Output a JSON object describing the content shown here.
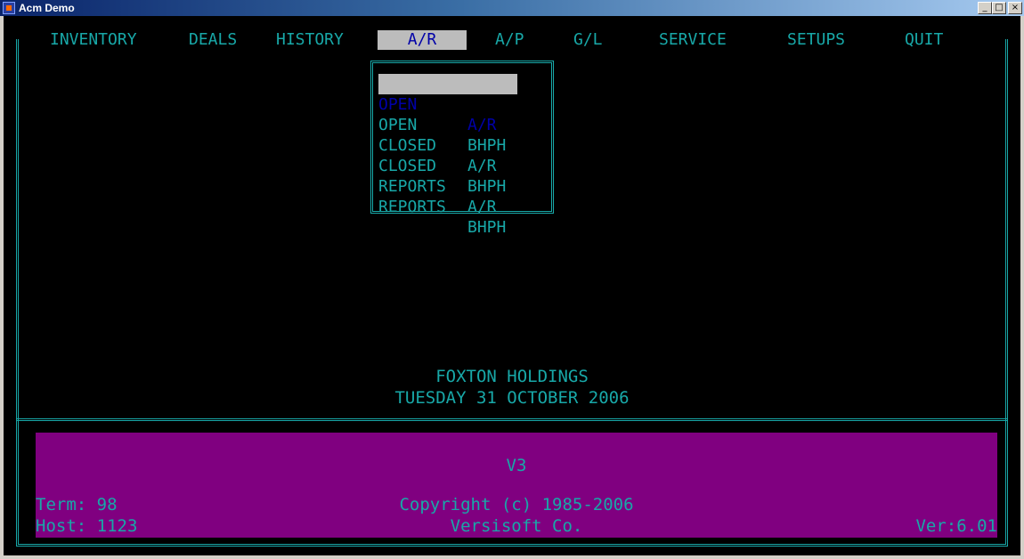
{
  "window": {
    "title": "Acm Demo",
    "controls": {
      "minimize": "_",
      "maximize": "□",
      "close": "×"
    }
  },
  "menu": {
    "items": [
      {
        "label": "INVENTORY"
      },
      {
        "label": "DEALS"
      },
      {
        "label": "HISTORY"
      },
      {
        "label": "A/R",
        "active": true
      },
      {
        "label": "A/P"
      },
      {
        "label": "G/L"
      },
      {
        "label": "SERVICE"
      },
      {
        "label": "SETUPS"
      },
      {
        "label": "QUIT"
      }
    ]
  },
  "dropdown": {
    "items": [
      {
        "a": "OPEN",
        "b": "A/R",
        "selected": true
      },
      {
        "a": "OPEN",
        "b": "BHPH"
      },
      {
        "a": "CLOSED",
        "b": "A/R"
      },
      {
        "a": "CLOSED",
        "b": "BHPH"
      },
      {
        "a": "REPORTS",
        "b": "A/R"
      },
      {
        "a": "REPORTS",
        "b": "BHPH"
      }
    ]
  },
  "company": {
    "name": "FOXTON HOLDINGS",
    "date": "TUESDAY 31 OCTOBER 2006"
  },
  "status": {
    "version_code": "V3",
    "term": "Term: 98",
    "host": "Host: 1123",
    "copyright": "Copyright (c) 1985-2006",
    "vendor": "Versisoft Co.",
    "ver": "Ver:6.01"
  },
  "colors": {
    "console_bg": "#000000",
    "text": "#18a8a8",
    "highlight_bg": "#bcbcbc",
    "highlight_text": "#0000a8",
    "status_bg": "#800080"
  }
}
